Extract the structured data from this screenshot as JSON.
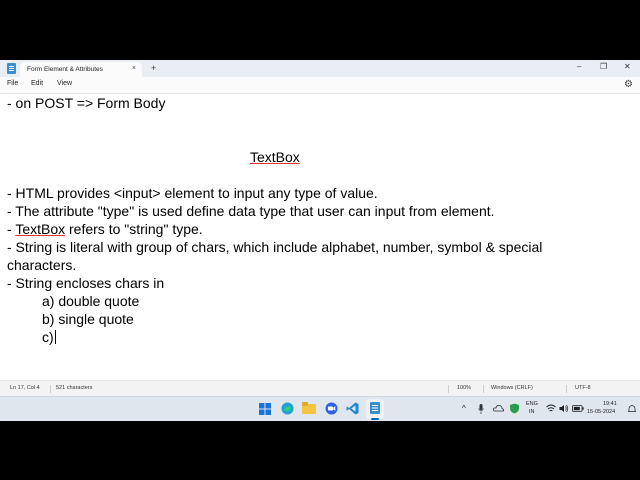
{
  "window": {
    "tab_title": "Form Element & Attributes",
    "tab_close": "×",
    "new_tab": "+",
    "minimize": "–",
    "maximize": "❐",
    "close": "✕"
  },
  "menu": {
    "file": "File",
    "edit": "Edit",
    "view": "View"
  },
  "editor": {
    "lines": [
      "- on POST => Form Body",
      "TextBox",
      "- HTML provides <input> element to input any type of value.",
      "- The attribute \"type\" is used define data type that user can input from element.",
      "- ",
      "TextBox",
      " refers to \"string\" type.",
      "- String is literal with group of chars, which include alphabet, number, symbol & special",
      "characters.",
      "- String encloses chars in",
      "a) double quote",
      "b) single quote",
      "c)"
    ]
  },
  "status": {
    "position": "Ln 17, Col 4",
    "chars": "521 characters",
    "zoom": "100%",
    "line_ending": "Windows (CRLF)",
    "encoding": "UTF-8"
  },
  "tray": {
    "lang_top": "ENG",
    "lang_bottom": "IN",
    "time": "19:41",
    "date": "15-05-2024",
    "chevron": "^"
  },
  "colors": {
    "accent": "#0067c0",
    "titlebar": "#e8eef3",
    "taskbar": "#dfe6ee"
  }
}
